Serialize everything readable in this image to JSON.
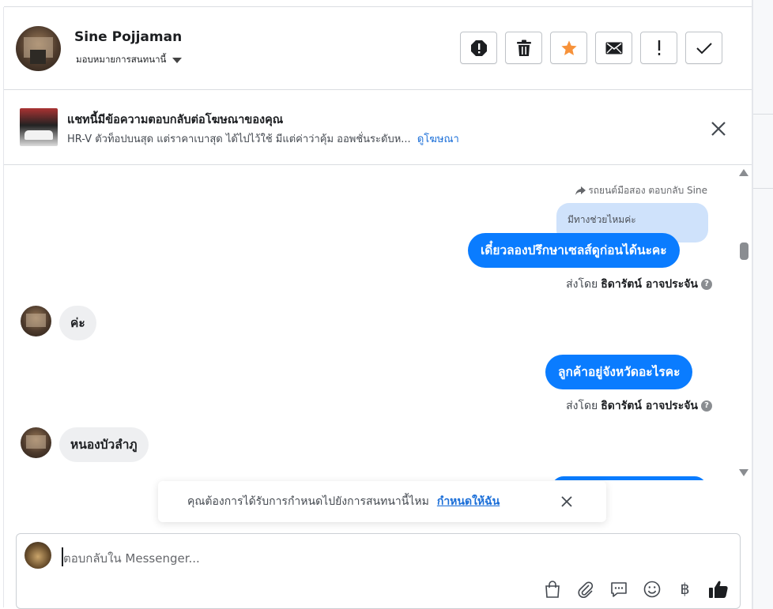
{
  "header": {
    "name": "Sine Pojjaman",
    "assign_label": "มอบหมายการสนทนานี้",
    "actions": [
      "spam-icon",
      "trash-icon",
      "star-icon",
      "mail-icon",
      "exclamation-icon",
      "check-icon"
    ],
    "star_color": "#f7923a"
  },
  "ad_banner": {
    "title": "แชทนี้มีข้อความตอบกลับต่อโฆษณาของคุณ",
    "description": "HR-V ตัวท็อปบนสุด แต่ราคาเบาสุด ได้ไปไว้ใช้ มีแต่ค่าว่าคุ้ม ออพชั่นระดับห...",
    "link": "ดูโฆษณา"
  },
  "conversation": {
    "reply_meta": "รถยนต์มือสอง ตอบกลับ Sine",
    "quoted_text": "มีทางช่วยไหมค่ะ",
    "messages": [
      {
        "direction": "out",
        "text": "เดี๋ยวลองปรึกษาเซลส์ดูก่อนได้นะคะ",
        "sent_by_prefix": "ส่งโดย",
        "sent_by_name": "ธิดารัตน์ อาจประจัน"
      },
      {
        "direction": "in",
        "text": "ค่ะ"
      },
      {
        "direction": "out",
        "text": "ลูกค้าอยู่จังหวัดอะไรคะ",
        "sent_by_prefix": "ส่งโดย",
        "sent_by_name": "ธิดารัตน์ อาจประจัน"
      },
      {
        "direction": "in",
        "text": "หนองบัวลำภู"
      }
    ],
    "help_glyph": "?",
    "outgoing_color": "#0a7cff",
    "incoming_color": "#eeeff1"
  },
  "toast": {
    "text": "คุณต้องการได้รับการกำหนดไปยังการสนทนานี้ไหม",
    "link": "กำหนดให้ฉัน"
  },
  "composer": {
    "placeholder": "ตอบกลับใน Messenger...",
    "tools": [
      "bag-icon",
      "paperclip-icon",
      "chat-icon",
      "emoji-icon",
      "baht-icon",
      "thumbs-up-icon"
    ],
    "baht_glyph": "฿"
  }
}
